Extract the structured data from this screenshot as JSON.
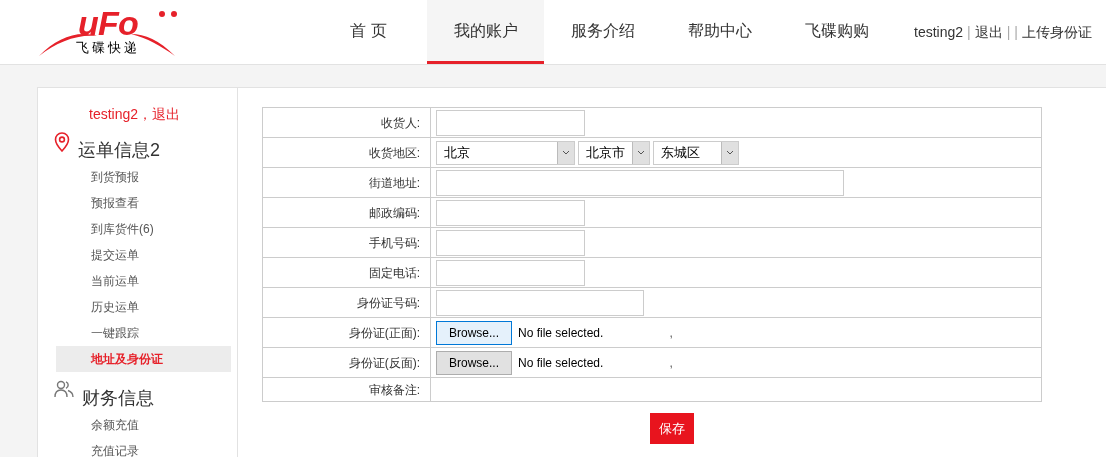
{
  "logo": {
    "mark": "uFo",
    "name": "飞碟快递"
  },
  "nav": [
    {
      "label": "首 页",
      "selected": false
    },
    {
      "label": "我的账户",
      "selected": true
    },
    {
      "label": "服务介绍",
      "selected": false
    },
    {
      "label": "帮助中心",
      "selected": false
    },
    {
      "label": "飞碟购购",
      "selected": false
    }
  ],
  "user_links": [
    {
      "kind": "link",
      "text": "testing2"
    },
    {
      "kind": "sep",
      "text": "|"
    },
    {
      "kind": "link",
      "text": "退出"
    },
    {
      "kind": "sep",
      "text": "|"
    },
    {
      "kind": "sep",
      "text": "|"
    },
    {
      "kind": "link",
      "text": "上传身份证"
    }
  ],
  "sidebar": {
    "user": "testing2，退出",
    "sections": [
      {
        "title": "运单信息2",
        "items": [
          {
            "label": "到货预报",
            "selected": false
          },
          {
            "label": "预报查看",
            "selected": false
          },
          {
            "label": "到库货件(6)",
            "selected": false
          },
          {
            "label": "提交运单",
            "selected": false
          },
          {
            "label": "当前运单",
            "selected": false
          },
          {
            "label": "历史运单",
            "selected": false
          },
          {
            "label": "一键跟踪",
            "selected": false
          },
          {
            "label": "地址及身份证",
            "selected": true
          }
        ]
      },
      {
        "title": "财务信息",
        "items": [
          {
            "label": "余额充值",
            "selected": false
          },
          {
            "label": "充值记录",
            "selected": false
          }
        ]
      }
    ]
  },
  "form": {
    "rows": [
      {
        "label": "收货人:",
        "kind": "short"
      },
      {
        "label": "收货地区:",
        "kind": "selects",
        "selects": [
          "北京",
          "北京市",
          "东城区"
        ]
      },
      {
        "label": "街道地址:",
        "kind": "long"
      },
      {
        "label": "邮政编码:",
        "kind": "short"
      },
      {
        "label": "手机号码:",
        "kind": "short"
      },
      {
        "label": "固定电话:",
        "kind": "short"
      },
      {
        "label": "身份证号码:",
        "kind": "medium"
      },
      {
        "label": "身份证(正面):",
        "kind": "file",
        "button": "Browse...",
        "status": "No file selected.",
        "suffix": ",",
        "focused": true
      },
      {
        "label": "身份证(反面):",
        "kind": "file",
        "button": "Browse...",
        "status": "No file selected.",
        "suffix": ",",
        "focused": false
      },
      {
        "label": "审核备注:",
        "kind": "note"
      }
    ],
    "save": "保存"
  }
}
